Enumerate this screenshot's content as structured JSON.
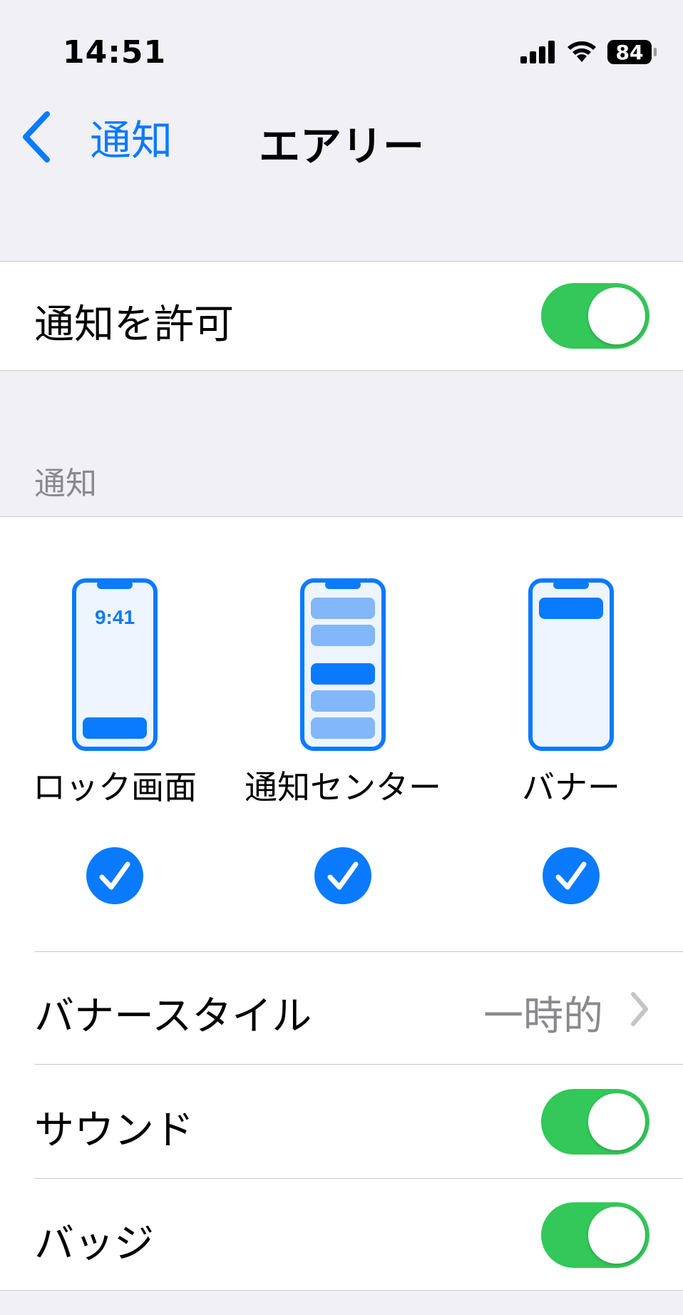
{
  "status": {
    "time": "14:51",
    "battery": "84"
  },
  "nav": {
    "back_label": "通知",
    "title": "エアリー"
  },
  "allow": {
    "label": "通知を許可",
    "on": true
  },
  "section_header": "通知",
  "styles": [
    {
      "label": "ロック画面",
      "checked": true,
      "clock": "9:41"
    },
    {
      "label": "通知センター",
      "checked": true
    },
    {
      "label": "バナー",
      "checked": true
    }
  ],
  "banner_style": {
    "label": "バナースタイル",
    "value": "一時的"
  },
  "sound": {
    "label": "サウンド",
    "on": true
  },
  "badge": {
    "label": "バッジ",
    "on": true
  },
  "colors": {
    "accent": "#0a7aff",
    "toggle_on": "#34c759",
    "group_bg": "#f0f0f5"
  }
}
